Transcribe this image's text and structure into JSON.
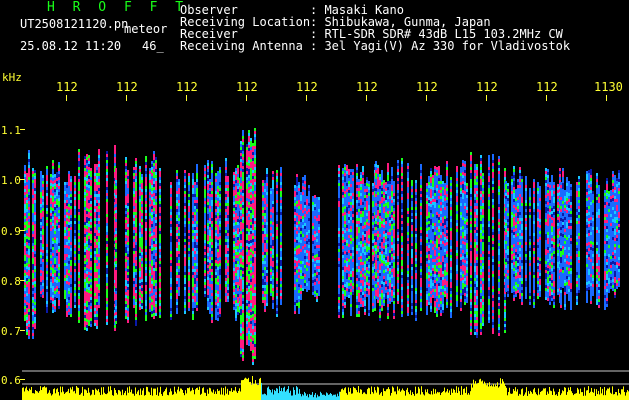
{
  "header": {
    "program_title": "H R O F F T",
    "filename": "UT2508121120.pn",
    "meteor_label": "meteor",
    "date_time": "25.08.12 11:20",
    "count": "46_",
    "fields": [
      {
        "label": "Observer",
        "value": ": Masaki Kano"
      },
      {
        "label": "Receiving Location",
        "value": ": Shibukawa, Gunma, Japan"
      },
      {
        "label": "Receiver",
        "value": ": RTL-SDR SDR# 43dB L15 103.2MHz CW"
      },
      {
        "label": "Receiving Antenna",
        "value": ": 3el Yagi(V) Az 330 for Vladivostok"
      }
    ]
  },
  "axes": {
    "y_unit": "kHz",
    "x_ticks": [
      "112",
      "112",
      "112",
      "112",
      "112",
      "112",
      "112",
      "112",
      "112",
      "1130"
    ],
    "y_ticks": [
      "1.1",
      "1.0",
      "0.9",
      "0.8",
      "0.7",
      "0.6"
    ]
  },
  "colors": {
    "background": "#000000",
    "text_green": "#19ff19",
    "text_white": "#ffffff",
    "axis_yellow": "#ffff33",
    "signal_low": "#0a1aa8",
    "signal_mid": "#19ff19",
    "signal_high": "#ff1a80",
    "level_yellow": "#ffff00",
    "level_cyan": "#33e0ff"
  }
}
